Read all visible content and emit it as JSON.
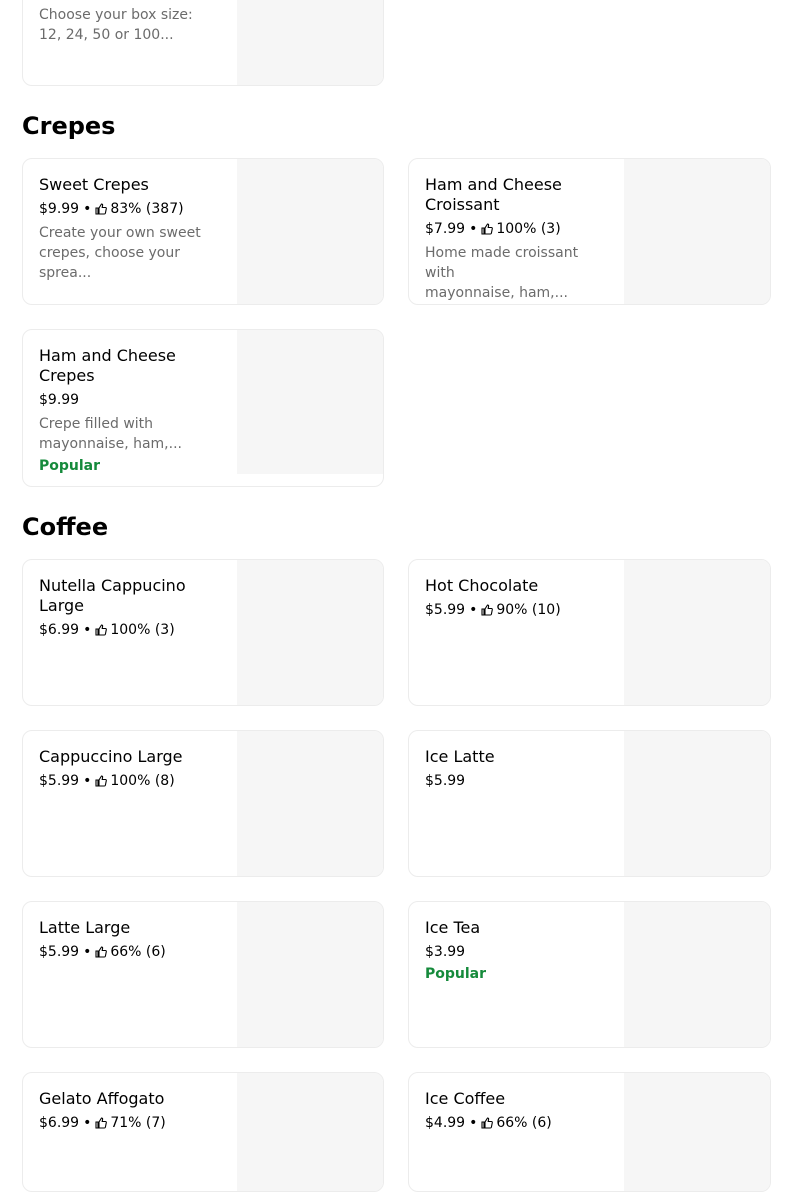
{
  "top_card": {
    "desc_line1": "Choose your box size:",
    "desc_line2": "12, 24, 50 or 100..."
  },
  "sections": [
    {
      "title": "Crepes",
      "items": [
        {
          "name_line1": "Sweet Crepes",
          "name_line2": "",
          "price": "$9.99",
          "rating": "83% (387)",
          "desc_line1": "Create your own sweet",
          "desc_line2": "crepes, choose your sprea...",
          "badge": ""
        },
        {
          "name_line1": "Ham and Cheese",
          "name_line2": "Croissant",
          "price": "$7.99",
          "rating": "100% (3)",
          "desc_line1": "Home made croissant with",
          "desc_line2": "mayonnaise, ham,...",
          "badge": ""
        },
        {
          "name_line1": "Ham and Cheese",
          "name_line2": "Crepes",
          "price": "$9.99",
          "rating": "",
          "desc_line1": "Crepe filled with",
          "desc_line2": "mayonnaise, ham,...",
          "badge": "Popular"
        }
      ]
    },
    {
      "title": "Coffee",
      "items": [
        {
          "name_line1": "Nutella Cappucino",
          "name_line2": "Large",
          "price": "$6.99",
          "rating": "100% (3)",
          "badge": ""
        },
        {
          "name_line1": "Hot Chocolate",
          "name_line2": "",
          "price": "$5.99",
          "rating": "90% (10)",
          "badge": ""
        },
        {
          "name_line1": "Cappuccino Large",
          "name_line2": "",
          "price": "$5.99",
          "rating": "100% (8)",
          "badge": ""
        },
        {
          "name_line1": "Ice Latte",
          "name_line2": "",
          "price": "$5.99",
          "rating": "",
          "badge": ""
        },
        {
          "name_line1": "Latte Large",
          "name_line2": "",
          "price": "$5.99",
          "rating": "66% (6)",
          "badge": ""
        },
        {
          "name_line1": "Ice Tea",
          "name_line2": "",
          "price": "$3.99",
          "rating": "",
          "badge": "Popular"
        },
        {
          "name_line1": "Gelato Affogato",
          "name_line2": "",
          "price": "$6.99",
          "rating": "71% (7)",
          "badge": ""
        },
        {
          "name_line1": "Ice Coffee",
          "name_line2": "",
          "price": "$4.99",
          "rating": "66% (6)",
          "badge": ""
        }
      ]
    }
  ],
  "icons": {
    "rating": "thumbs-up-icon"
  },
  "colors": {
    "popular": "#158a3b",
    "description": "#6b6b6b",
    "image_placeholder": "#f6f6f6"
  }
}
